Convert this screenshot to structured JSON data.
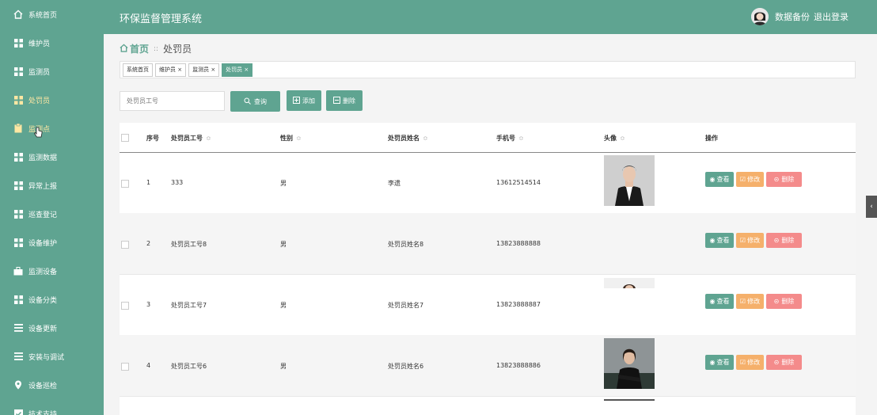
{
  "sidebar": {
    "items": [
      {
        "label": "系统首页",
        "icon": "home-icon"
      },
      {
        "label": "维护员",
        "icon": "grid-icon"
      },
      {
        "label": "监测员",
        "icon": "grid-icon"
      },
      {
        "label": "处罚员",
        "icon": "grid-icon"
      },
      {
        "label": "监测点",
        "icon": "clipboard-icon"
      },
      {
        "label": "监测数据",
        "icon": "grid-icon"
      },
      {
        "label": "异常上报",
        "icon": "grid-icon"
      },
      {
        "label": "巡查登记",
        "icon": "grid-icon"
      },
      {
        "label": "设备维护",
        "icon": "grid-icon"
      },
      {
        "label": "监测设备",
        "icon": "briefcase-icon"
      },
      {
        "label": "设备分类",
        "icon": "grid-icon"
      },
      {
        "label": "设备更新",
        "icon": "menu-icon"
      },
      {
        "label": "安装与调试",
        "icon": "menu-icon"
      },
      {
        "label": "设备巡检",
        "icon": "location-icon"
      },
      {
        "label": "技术支持",
        "icon": "checkbox-icon"
      }
    ]
  },
  "header": {
    "title": "环保监督管理系统",
    "backup": "数据备份",
    "logout": "退出登录"
  },
  "breadcrumb": {
    "home": "首页",
    "sep": "::",
    "current": "处罚员"
  },
  "tabs": [
    "系统首页",
    "维护员 ×",
    "监测员 ×",
    "处罚员 ×"
  ],
  "search": {
    "placeholder": "处罚员工号",
    "query_label": "查询",
    "add_label": "添加",
    "delete_label": "删除"
  },
  "table": {
    "headers": {
      "seq": "序号",
      "emp_no": "处罚员工号",
      "gender": "性别",
      "name": "处罚员姓名",
      "phone": "手机号",
      "avatar": "头像",
      "ops": "操作"
    },
    "sort_glyph": "≎",
    "rows": [
      {
        "seq": "1",
        "emp_no": "333",
        "gender": "男",
        "name": "李遗",
        "phone": "13612514514"
      },
      {
        "seq": "2",
        "emp_no": "处罚员工号8",
        "gender": "男",
        "name": "处罚员姓名8",
        "phone": "13823888888"
      },
      {
        "seq": "3",
        "emp_no": "处罚员工号7",
        "gender": "男",
        "name": "处罚员姓名7",
        "phone": "13823888887"
      },
      {
        "seq": "4",
        "emp_no": "处罚员工号6",
        "gender": "男",
        "name": "处罚员姓名6",
        "phone": "13823888886"
      }
    ],
    "actions": {
      "view": "查看",
      "edit": "修改",
      "delete": "删除"
    }
  },
  "colors": {
    "primary": "#5fa491",
    "warning": "#f5b06b",
    "danger": "#f48b8b",
    "active_nav": "#ffe7a3"
  }
}
